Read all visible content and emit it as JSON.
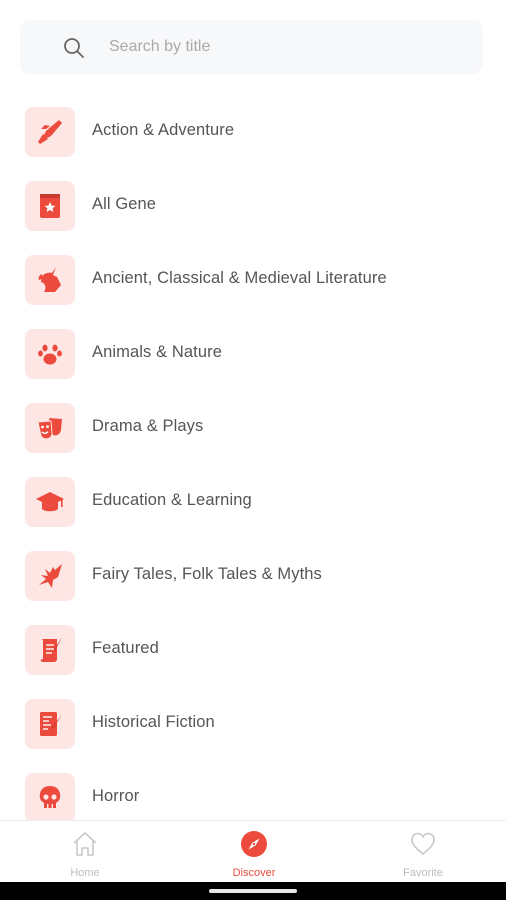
{
  "search": {
    "placeholder": "Search by title",
    "icon": "search-icon"
  },
  "categories": [
    {
      "label": "Action & Adventure",
      "icon": "rocket-icon"
    },
    {
      "label": "All Gene",
      "icon": "book-star-icon"
    },
    {
      "label": "Ancient, Classical & Medieval Literature",
      "icon": "unicorn-icon"
    },
    {
      "label": "Animals & Nature",
      "icon": "paw-icon"
    },
    {
      "label": "Drama & Plays",
      "icon": "theater-masks-icon"
    },
    {
      "label": "Education & Learning",
      "icon": "graduation-cap-icon"
    },
    {
      "label": "Fairy Tales, Folk Tales & Myths",
      "icon": "dragon-icon"
    },
    {
      "label": "Featured",
      "icon": "scroll-quill-icon"
    },
    {
      "label": "Historical Fiction",
      "icon": "document-quill-icon"
    },
    {
      "label": "Horror",
      "icon": "skull-icon"
    }
  ],
  "tabs": [
    {
      "label": "Home",
      "icon": "home-icon",
      "active": false
    },
    {
      "label": "Discover",
      "icon": "compass-icon",
      "active": true
    },
    {
      "label": "Favorite",
      "icon": "heart-icon",
      "active": false
    }
  ],
  "colors": {
    "accent": "#ec4a3c",
    "badge_bg": "#fde6e4",
    "text": "#555555",
    "inactive_tab": "#bdbdbd"
  }
}
